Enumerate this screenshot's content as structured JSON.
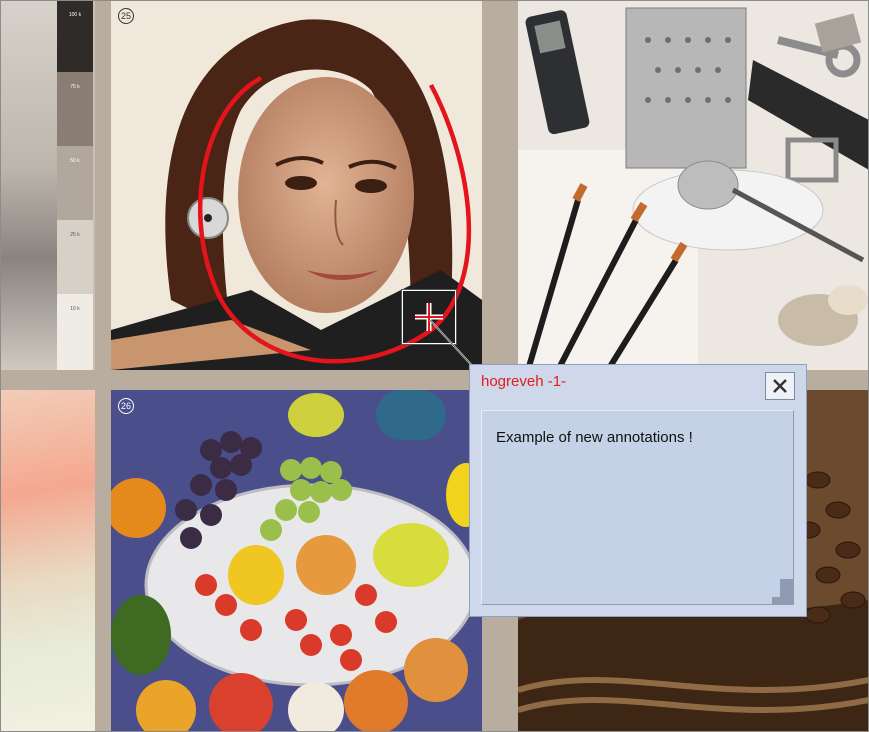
{
  "annotation": {
    "author": "hogreveh -1-",
    "content": "Example of new annotations !",
    "close_icon": "close-icon",
    "anchor_icon": "crosshair-icon",
    "title_color": "#e21d1d",
    "background_color": "#cfd8ea"
  },
  "images": {
    "top_left": "portrait of a woman with red freehand circle",
    "top_right": "still life with phone, grater, belt, brushes",
    "bottom_left": "fruit bowl with grapes, pears, strawberries",
    "bottom_right": "coffee beans and rope texture"
  },
  "swatches": [
    "100 k",
    "75 k",
    "50 k",
    "25 k",
    "10 k"
  ],
  "page_numbers": [
    "25",
    "26"
  ]
}
